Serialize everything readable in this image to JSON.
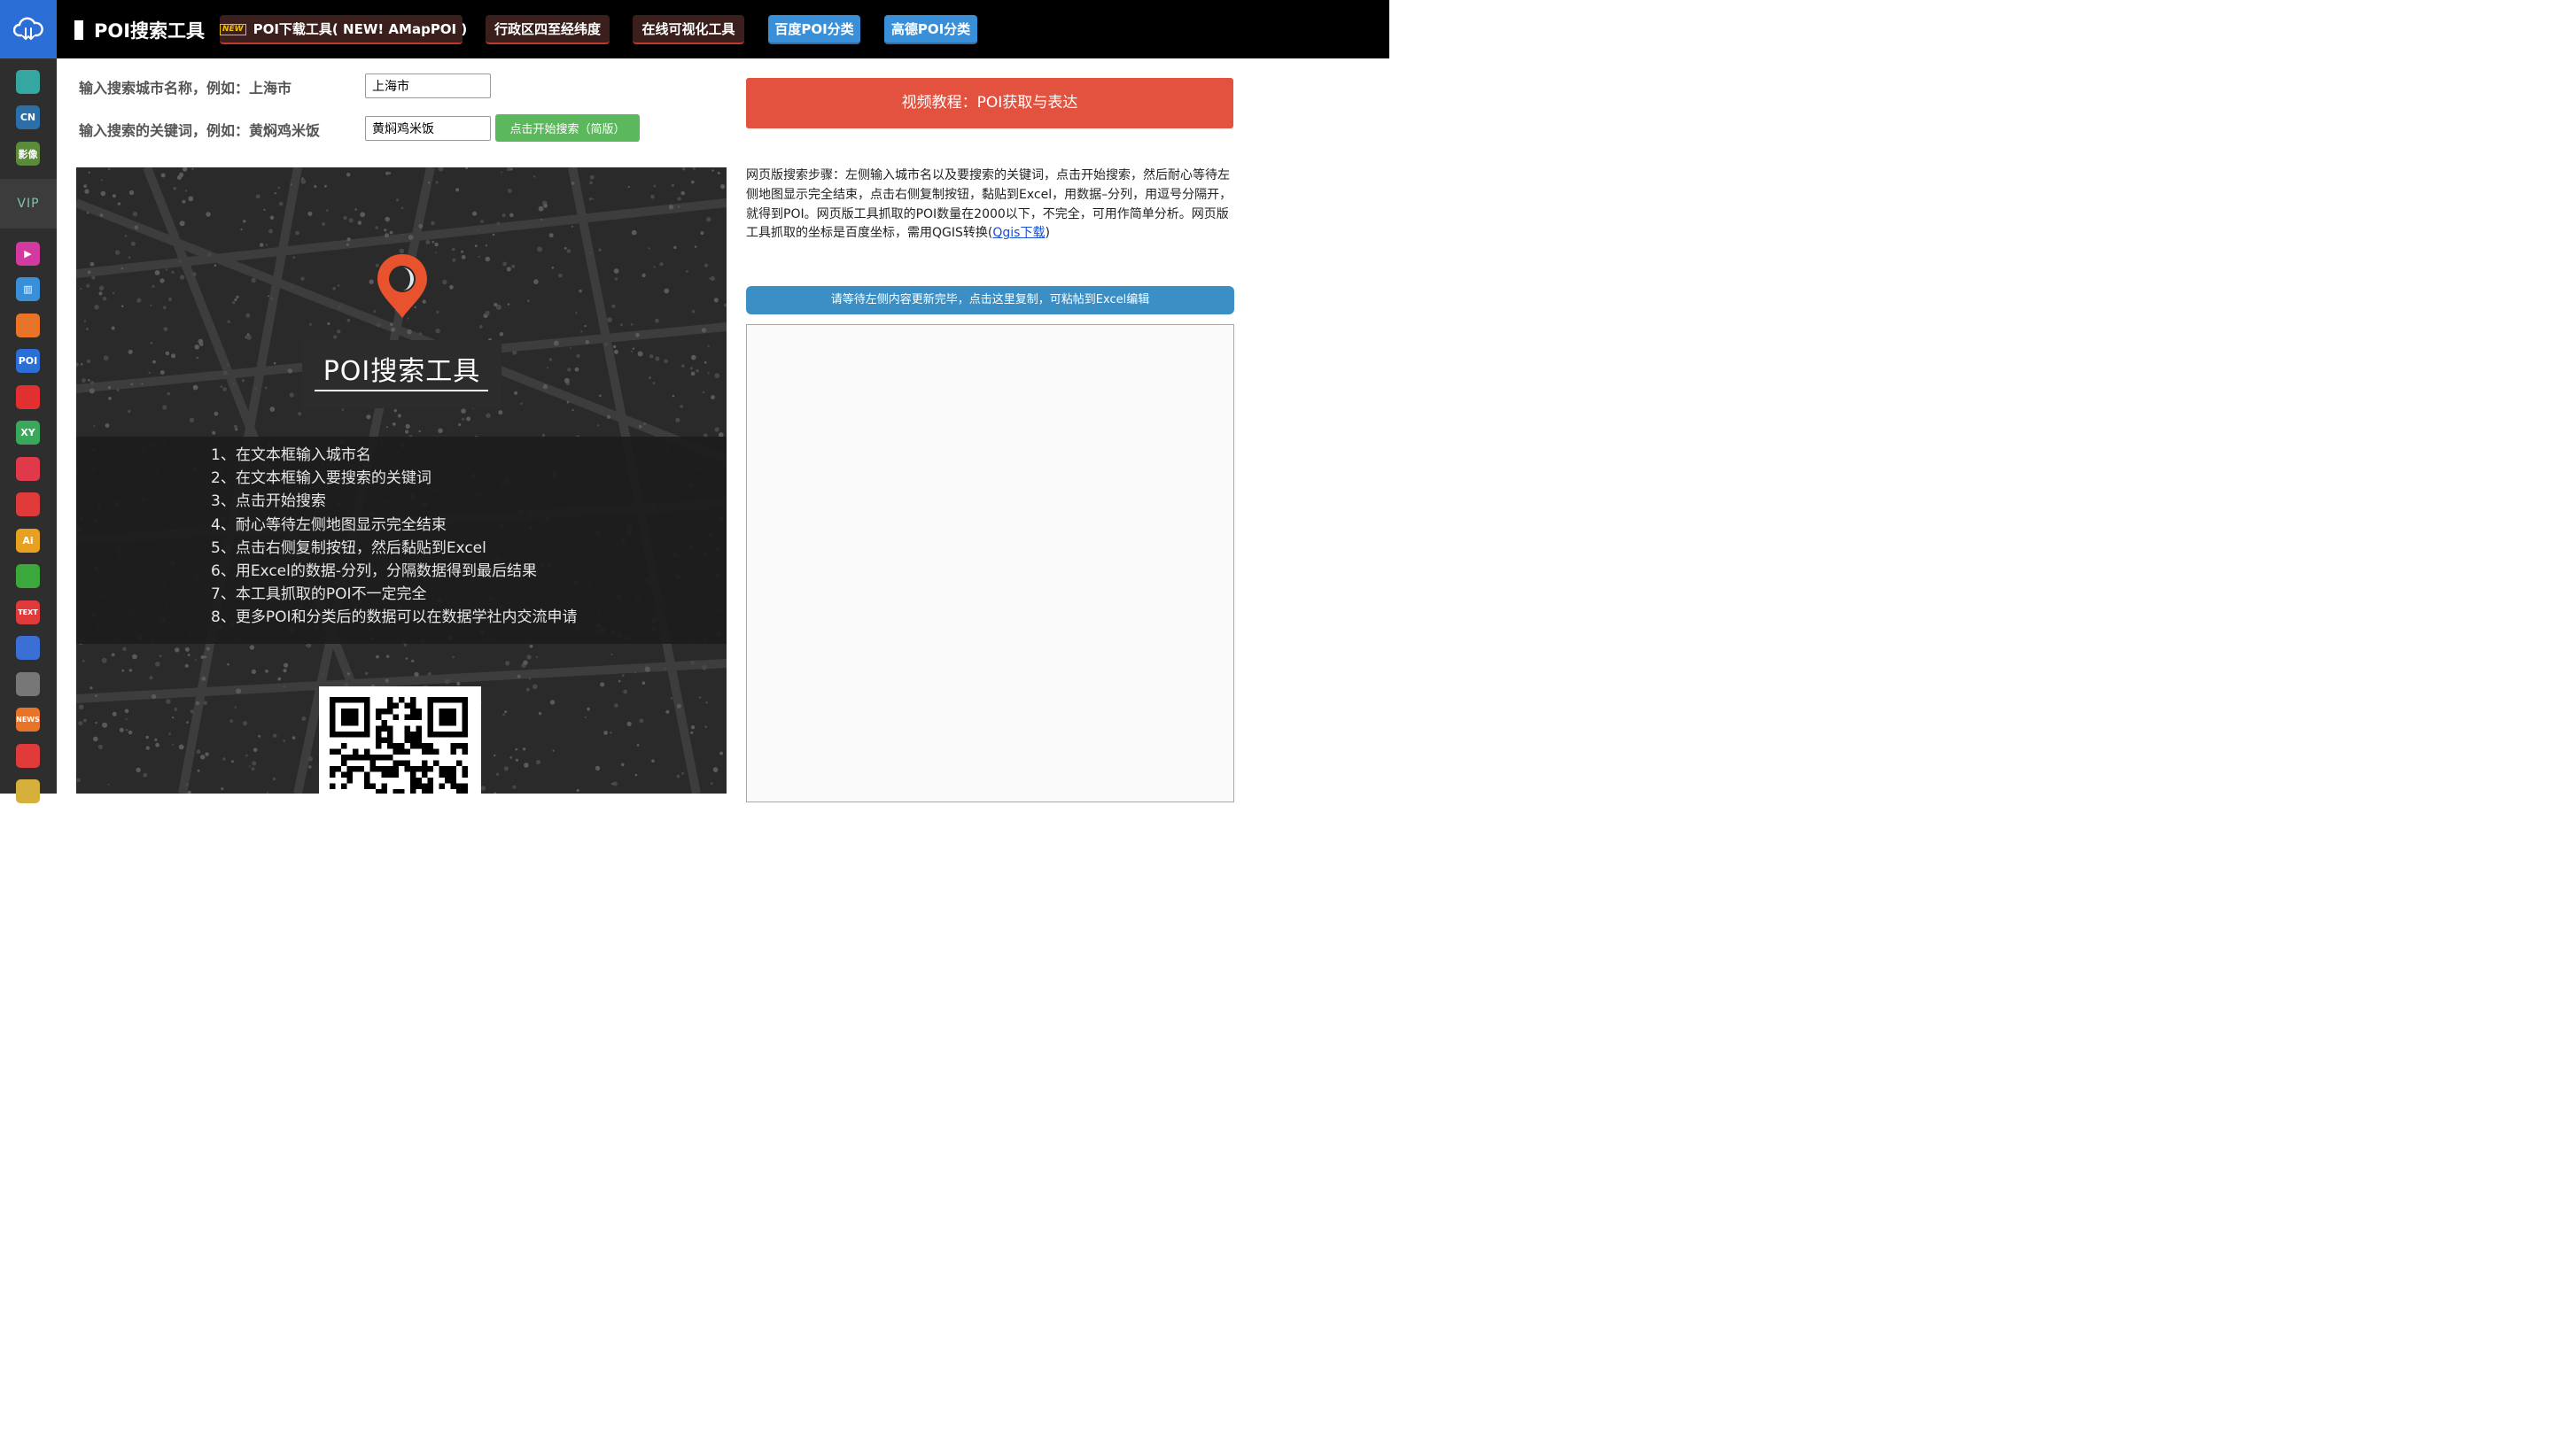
{
  "header": {
    "brand": "POI搜索工具",
    "new_badge": "NEW",
    "nav": [
      {
        "label": "POI下载工具( NEW! AMapPOI )",
        "style": "dark"
      },
      {
        "label": "行政区四至经纬度",
        "style": "dark"
      },
      {
        "label": "在线可视化工具",
        "style": "dark"
      },
      {
        "label": "百度POI分类",
        "style": "blue"
      },
      {
        "label": "高德POI分类",
        "style": "blue"
      }
    ]
  },
  "sidebar": {
    "vip_label": "VIP",
    "items": [
      {
        "icon": "search-icon",
        "text": "",
        "color": "#35a6a0"
      },
      {
        "icon": "ai-cn-icon",
        "text": "CN",
        "color": "#2c6fa8"
      },
      {
        "icon": "image-icon",
        "text": "影像",
        "color": "#5a8a3a"
      },
      {
        "icon": "video-icon",
        "text": "▶",
        "color": "#d33aa0"
      },
      {
        "icon": "book-icon",
        "text": "▥",
        "color": "#3a8fd9"
      },
      {
        "icon": "map-china-icon",
        "text": "",
        "color": "#e8742a"
      },
      {
        "icon": "poi-icon",
        "text": "POI",
        "color": "#2b6fd6"
      },
      {
        "icon": "pie-chart-icon",
        "text": "",
        "color": "#e03030"
      },
      {
        "icon": "xy-icon",
        "text": "XY",
        "color": "#3aa85a"
      },
      {
        "icon": "bulb-icon",
        "text": "",
        "color": "#e03a4a"
      },
      {
        "icon": "picture-icon",
        "text": "",
        "color": "#e03a3a"
      },
      {
        "icon": "ai-icon",
        "text": "Ai",
        "color": "#e8a020"
      },
      {
        "icon": "road-icon",
        "text": "",
        "color": "#3aa83a"
      },
      {
        "icon": "text-icon",
        "text": "TEXT",
        "color": "#e03a3a"
      },
      {
        "icon": "bar-chart-icon",
        "text": "",
        "color": "#3a6fd6"
      },
      {
        "icon": "color-wheel-icon",
        "text": "",
        "color": "#777777"
      },
      {
        "icon": "news-icon",
        "text": "NEWS",
        "color": "#e8742a"
      },
      {
        "icon": "document-icon",
        "text": "",
        "color": "#e03a3a"
      },
      {
        "icon": "folder-icon",
        "text": "",
        "color": "#d6b03a"
      }
    ]
  },
  "form": {
    "city_label": "输入搜索城市名称，例如：上海市",
    "city_value": "上海市",
    "keyword_label": "输入搜索的关键词，例如：黄焖鸡米饭",
    "keyword_value": "黄焖鸡米饭",
    "search_button": "点击开始搜索（简版）"
  },
  "poster": {
    "title": "POI搜索工具",
    "steps": [
      "1、在文本框输入城市名",
      "2、在文本框输入要搜索的关键词",
      "3、点击开始搜索",
      "4、耐心等待左侧地图显示完全结束",
      "5、点击右侧复制按钮，然后黏贴到Excel",
      "6、用Excel的数据-分列，分隔数据得到最后结果",
      "7、本工具抓取的POI不一定完全",
      "8、更多POI和分类后的数据可以在数据学社内交流申请"
    ]
  },
  "right": {
    "video_button": "视频教程：POI获取与表达",
    "instructions": "网页版搜索步骤：左侧输入城市名以及要搜索的关键词，点击开始搜索，然后耐心等待左侧地图显示完全结束，点击右侧复制按钮，黏贴到Excel，用数据–分列，用逗号分隔开，就得到POI。网页版工具抓取的POI数量在2000以下，不完全，可用作简单分析。网页版工具抓取的坐标是百度坐标，需用QGIS转换(",
    "qgis_link": "Qgis下载",
    "instructions_end": ")",
    "copy_button": "请等待左侧内容更新完毕，点击这里复制，可粘帖到Excel编辑"
  },
  "colors": {
    "topbar": "#000000",
    "sidebar": "#2e2e2e",
    "video_button": "#e2523f",
    "copy_button": "#3c8fc4",
    "search_button": "#5cb85c",
    "nav_dark": "#3a1f1c",
    "nav_blue": "#3a8fd9"
  }
}
